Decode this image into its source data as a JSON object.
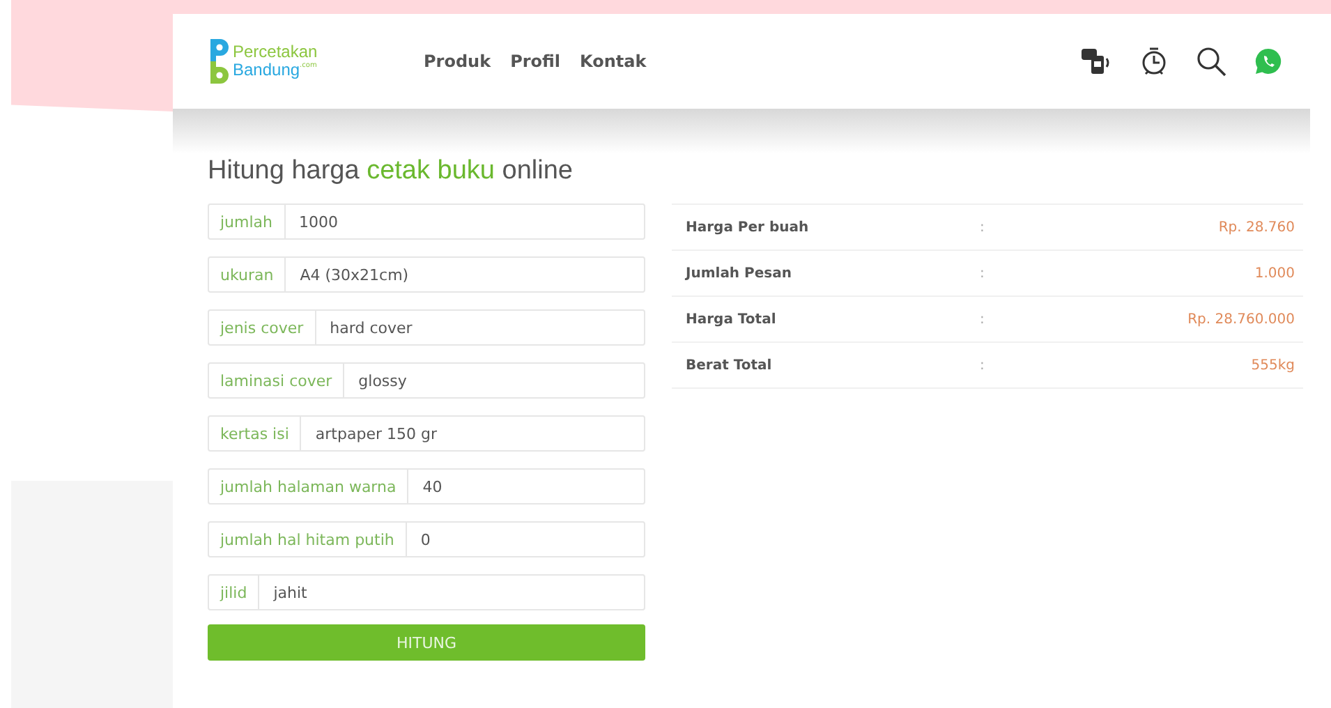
{
  "logo": {
    "line1": "Percetakan",
    "line2": "Bandung",
    "suffix": ".com"
  },
  "nav": [
    {
      "label": "Produk"
    },
    {
      "label": "Profil"
    },
    {
      "label": "Kontak"
    }
  ],
  "title": [
    {
      "text": "Hitung harga ",
      "highlight": false
    },
    {
      "text": "cetak buku",
      "highlight": true
    },
    {
      "text": " online",
      "highlight": false
    }
  ],
  "form": [
    {
      "label": "jumlah",
      "value": "1000"
    },
    {
      "label": "ukuran",
      "value": "A4 (30x21cm)"
    },
    {
      "label": "jenis cover",
      "value": "hard cover"
    },
    {
      "label": "laminasi cover",
      "value": "glossy"
    },
    {
      "label": "kertas isi",
      "value": "artpaper 150 gr"
    },
    {
      "label": "jumlah halaman warna",
      "value": "40"
    },
    {
      "label": "jumlah hal hitam putih",
      "value": "0"
    },
    {
      "label": "jilid",
      "value": "jahit"
    }
  ],
  "submit": "HITUNG",
  "results": [
    {
      "label": "Harga Per buah",
      "sep": ":",
      "value": "Rp. 28.760"
    },
    {
      "label": "Jumlah Pesan",
      "sep": ":",
      "value": "1.000"
    },
    {
      "label": "Harga Total",
      "sep": ":",
      "value": "Rp. 28.760.000"
    },
    {
      "label": "Berat Total",
      "sep": ":",
      "value": "555kg"
    }
  ]
}
